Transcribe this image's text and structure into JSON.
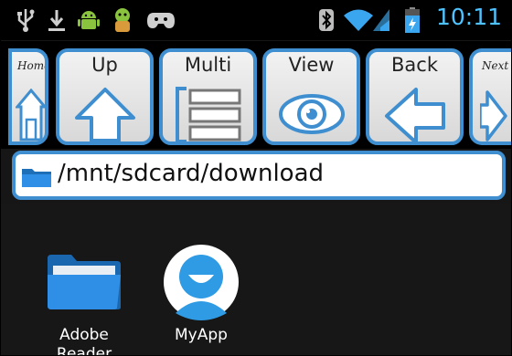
{
  "status_bar": {
    "time": "10:11",
    "icons": [
      "usb-icon",
      "download-icon",
      "android-icon",
      "android-head-icon",
      "gamepad-icon",
      "bluetooth-icon",
      "wifi-icon",
      "signal-icon",
      "battery-icon"
    ]
  },
  "toolbar": {
    "home_label": "Home",
    "up_label": "Up",
    "multi_label": "Multi",
    "view_label": "View",
    "back_label": "Back",
    "next_label": "Next"
  },
  "path_bar": {
    "path": "/mnt/sdcard/download"
  },
  "files": [
    {
      "name": "Adobe Reader",
      "icon": "folder-icon"
    },
    {
      "name": "MyApp",
      "icon": "app-icon"
    }
  ],
  "colors": {
    "accent": "#3f8fd0",
    "time": "#4ec3ff",
    "folder": "#2f8ee6"
  }
}
